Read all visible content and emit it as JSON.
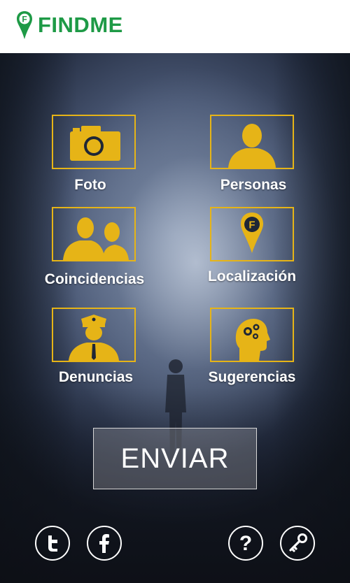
{
  "app": {
    "name": "FINDME",
    "brand_color": "#1e9a46",
    "accent_color": "#e6b417"
  },
  "menu": [
    {
      "label": "Foto",
      "icon": "camera-icon"
    },
    {
      "label": "Personas",
      "icon": "person-icon"
    },
    {
      "label": "Coincidencias",
      "icon": "two-persons-icon"
    },
    {
      "label": "Localización",
      "icon": "location-pin-icon"
    },
    {
      "label": "Denuncias",
      "icon": "police-officer-icon"
    },
    {
      "label": "Sugerencias",
      "icon": "head-gears-icon"
    }
  ],
  "submit": {
    "label": "ENVIAR"
  },
  "footer": [
    {
      "icon": "twitter-icon"
    },
    {
      "icon": "facebook-icon"
    },
    {
      "icon": "help-icon"
    },
    {
      "icon": "key-icon"
    }
  ]
}
